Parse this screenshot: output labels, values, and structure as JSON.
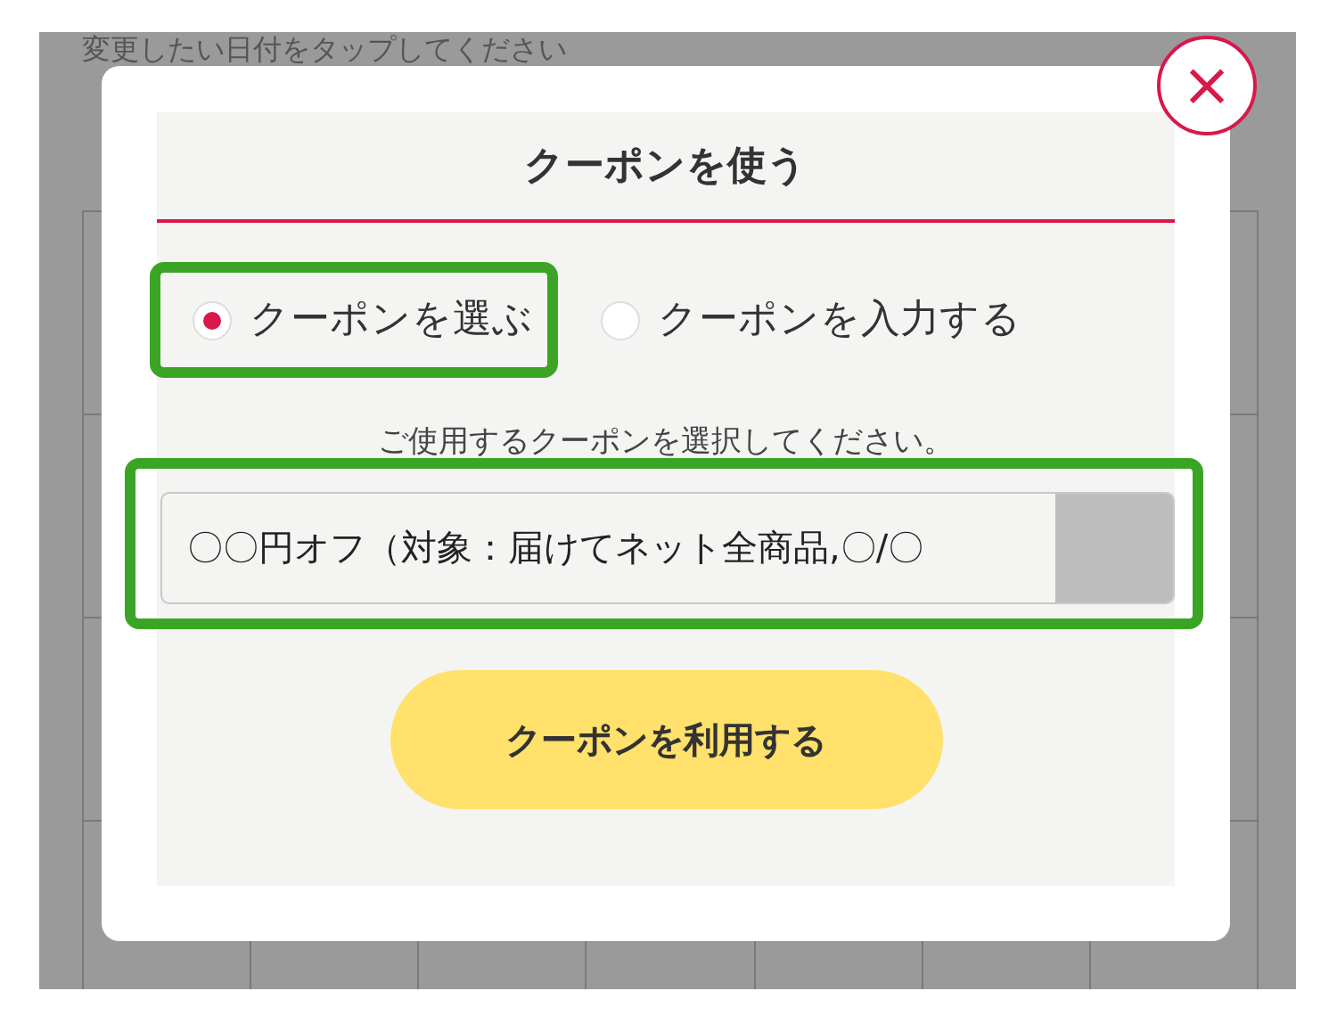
{
  "background": {
    "instruction": "変更したい日付をタップしてください"
  },
  "dialog": {
    "title": "クーポンを使う",
    "close": "×",
    "modes": [
      {
        "label": "クーポンを選ぶ",
        "selected": true,
        "highlighted": true
      },
      {
        "label": "クーポンを入力する",
        "selected": false,
        "highlighted": false
      }
    ],
    "prompt": "ご使用するクーポンを選択してください。",
    "coupon_select": {
      "value": "〇〇円オフ（対象：届けてネット全商品,〇/〇",
      "highlighted": true
    },
    "submit": "クーポンを利用する"
  }
}
